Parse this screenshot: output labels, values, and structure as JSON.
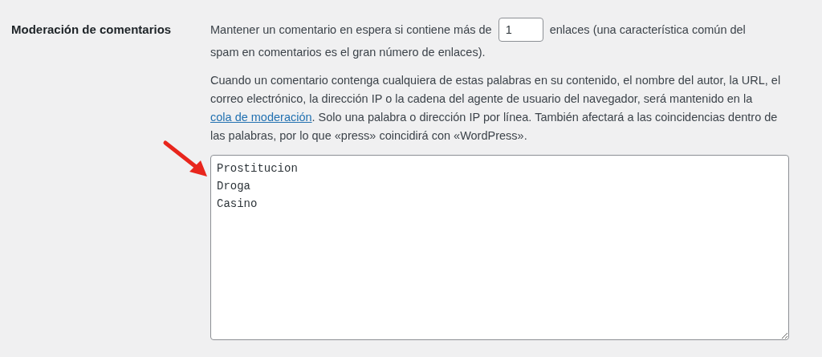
{
  "setting": {
    "label": "Moderación de comentarios"
  },
  "link_limit": {
    "text_before": "Mantener un comentario en espera si contiene más de",
    "value": "1",
    "text_after": "enlaces (una característica común del",
    "continuation": "spam en comentarios es el gran número de enlaces)."
  },
  "keywords_help": {
    "text_before": "Cuando un comentario contenga cualquiera de estas palabras en su contenido, el nombre del autor, la URL, el correo electrónico, la dirección IP o la cadena del agente de usuario del navegador, será mantenido en la",
    "link": "cola de moderación",
    "text_after": ". Solo una palabra o dirección IP por línea. También afectará a las coincidencias dentro de las palabras, por lo que «press» coincidirá con «WordPress»."
  },
  "keywords_field": {
    "value": "Prostitucion\nDroga\nCasino"
  }
}
